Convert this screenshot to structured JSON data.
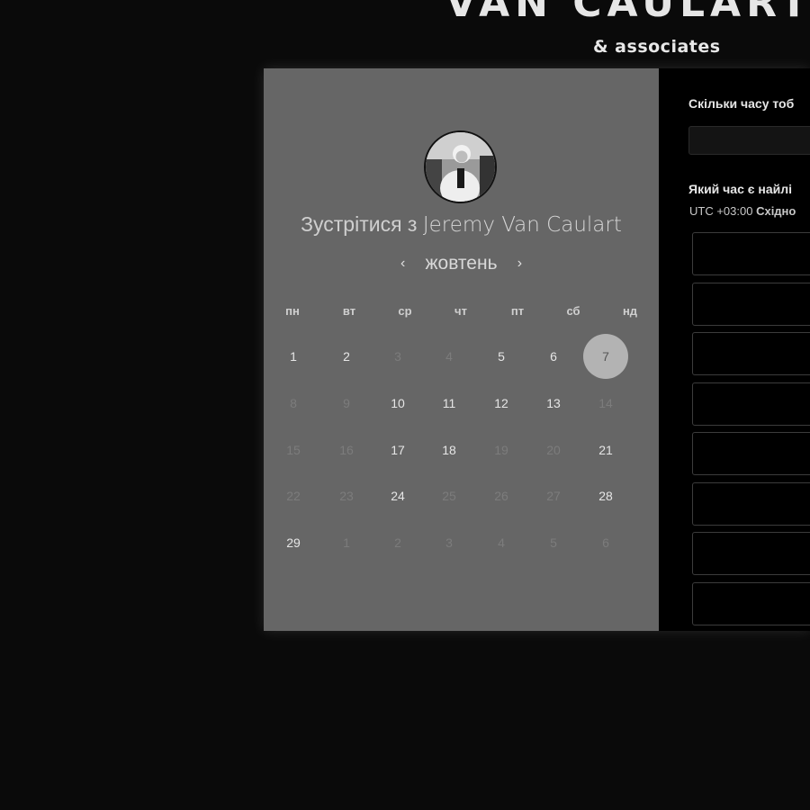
{
  "brand": {
    "name": "VAN CAULART",
    "tagline": "& associates"
  },
  "booking": {
    "title_prefix": "Зустрітися з",
    "host_name": "Jeremy Van Caulart",
    "month": "жовтень",
    "prev_icon": "‹",
    "next_icon": "›",
    "weekdays": [
      "пн",
      "вт",
      "ср",
      "чт",
      "пт",
      "сб",
      "нд"
    ],
    "days": [
      {
        "label": "1",
        "available": true
      },
      {
        "label": "2",
        "available": true
      },
      {
        "label": "3",
        "available": false
      },
      {
        "label": "4",
        "available": false
      },
      {
        "label": "5",
        "available": true
      },
      {
        "label": "6",
        "available": true
      },
      {
        "label": "7",
        "available": true,
        "selected": true
      },
      {
        "label": "8",
        "available": false
      },
      {
        "label": "9",
        "available": false
      },
      {
        "label": "10",
        "available": true
      },
      {
        "label": "11",
        "available": true
      },
      {
        "label": "12",
        "available": true
      },
      {
        "label": "13",
        "available": true
      },
      {
        "label": "14",
        "available": false
      },
      {
        "label": "15",
        "available": false
      },
      {
        "label": "16",
        "available": false
      },
      {
        "label": "17",
        "available": true
      },
      {
        "label": "18",
        "available": true
      },
      {
        "label": "19",
        "available": false
      },
      {
        "label": "20",
        "available": false
      },
      {
        "label": "21",
        "available": true
      },
      {
        "label": "22",
        "available": false
      },
      {
        "label": "23",
        "available": false
      },
      {
        "label": "24",
        "available": true
      },
      {
        "label": "25",
        "available": false
      },
      {
        "label": "26",
        "available": false
      },
      {
        "label": "27",
        "available": false
      },
      {
        "label": "28",
        "available": true
      },
      {
        "label": "29",
        "available": true
      },
      {
        "label": "1",
        "available": false
      },
      {
        "label": "2",
        "available": false
      },
      {
        "label": "3",
        "available": false
      },
      {
        "label": "4",
        "available": false
      },
      {
        "label": "5",
        "available": false
      },
      {
        "label": "6",
        "available": false
      }
    ]
  },
  "right": {
    "duration_question": "Скільки часу тоб",
    "time_question": "Який час є найлі",
    "tz_offset": "UTC +03:00",
    "tz_name": "Східно",
    "slot_count": 8
  },
  "colors": {
    "page_bg": "#0a0a0a",
    "calendar_bg": "#666666",
    "selected_day_bg": "#b3b3b3",
    "right_bg": "#000000"
  }
}
